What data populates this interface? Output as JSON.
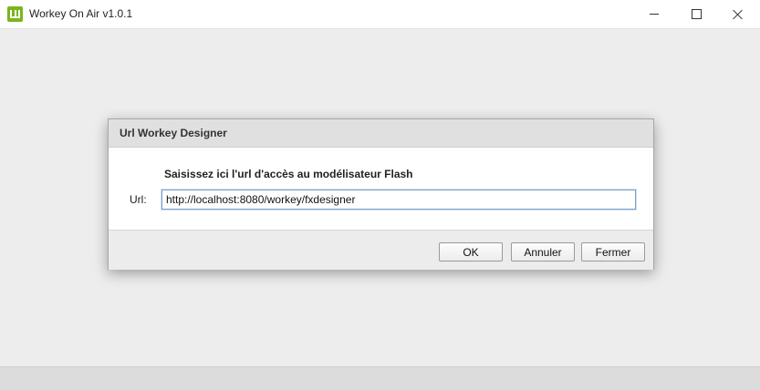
{
  "window": {
    "title": "Workey On Air v1.0.1",
    "icon": "workey-logo-icon",
    "accent": "#7ab51d",
    "controls": {
      "minimize": "minimize-icon",
      "maximize": "maximize-icon",
      "close": "close-icon"
    }
  },
  "dialog": {
    "title": "Url Workey Designer",
    "prompt": "Saisissez ici l'url d'accès au modélisateur Flash",
    "url_label": "Url:",
    "url_value": "http://localhost:8080/workey/fxdesigner",
    "buttons": {
      "ok": "OK",
      "cancel": "Annuler",
      "close": "Fermer"
    }
  }
}
